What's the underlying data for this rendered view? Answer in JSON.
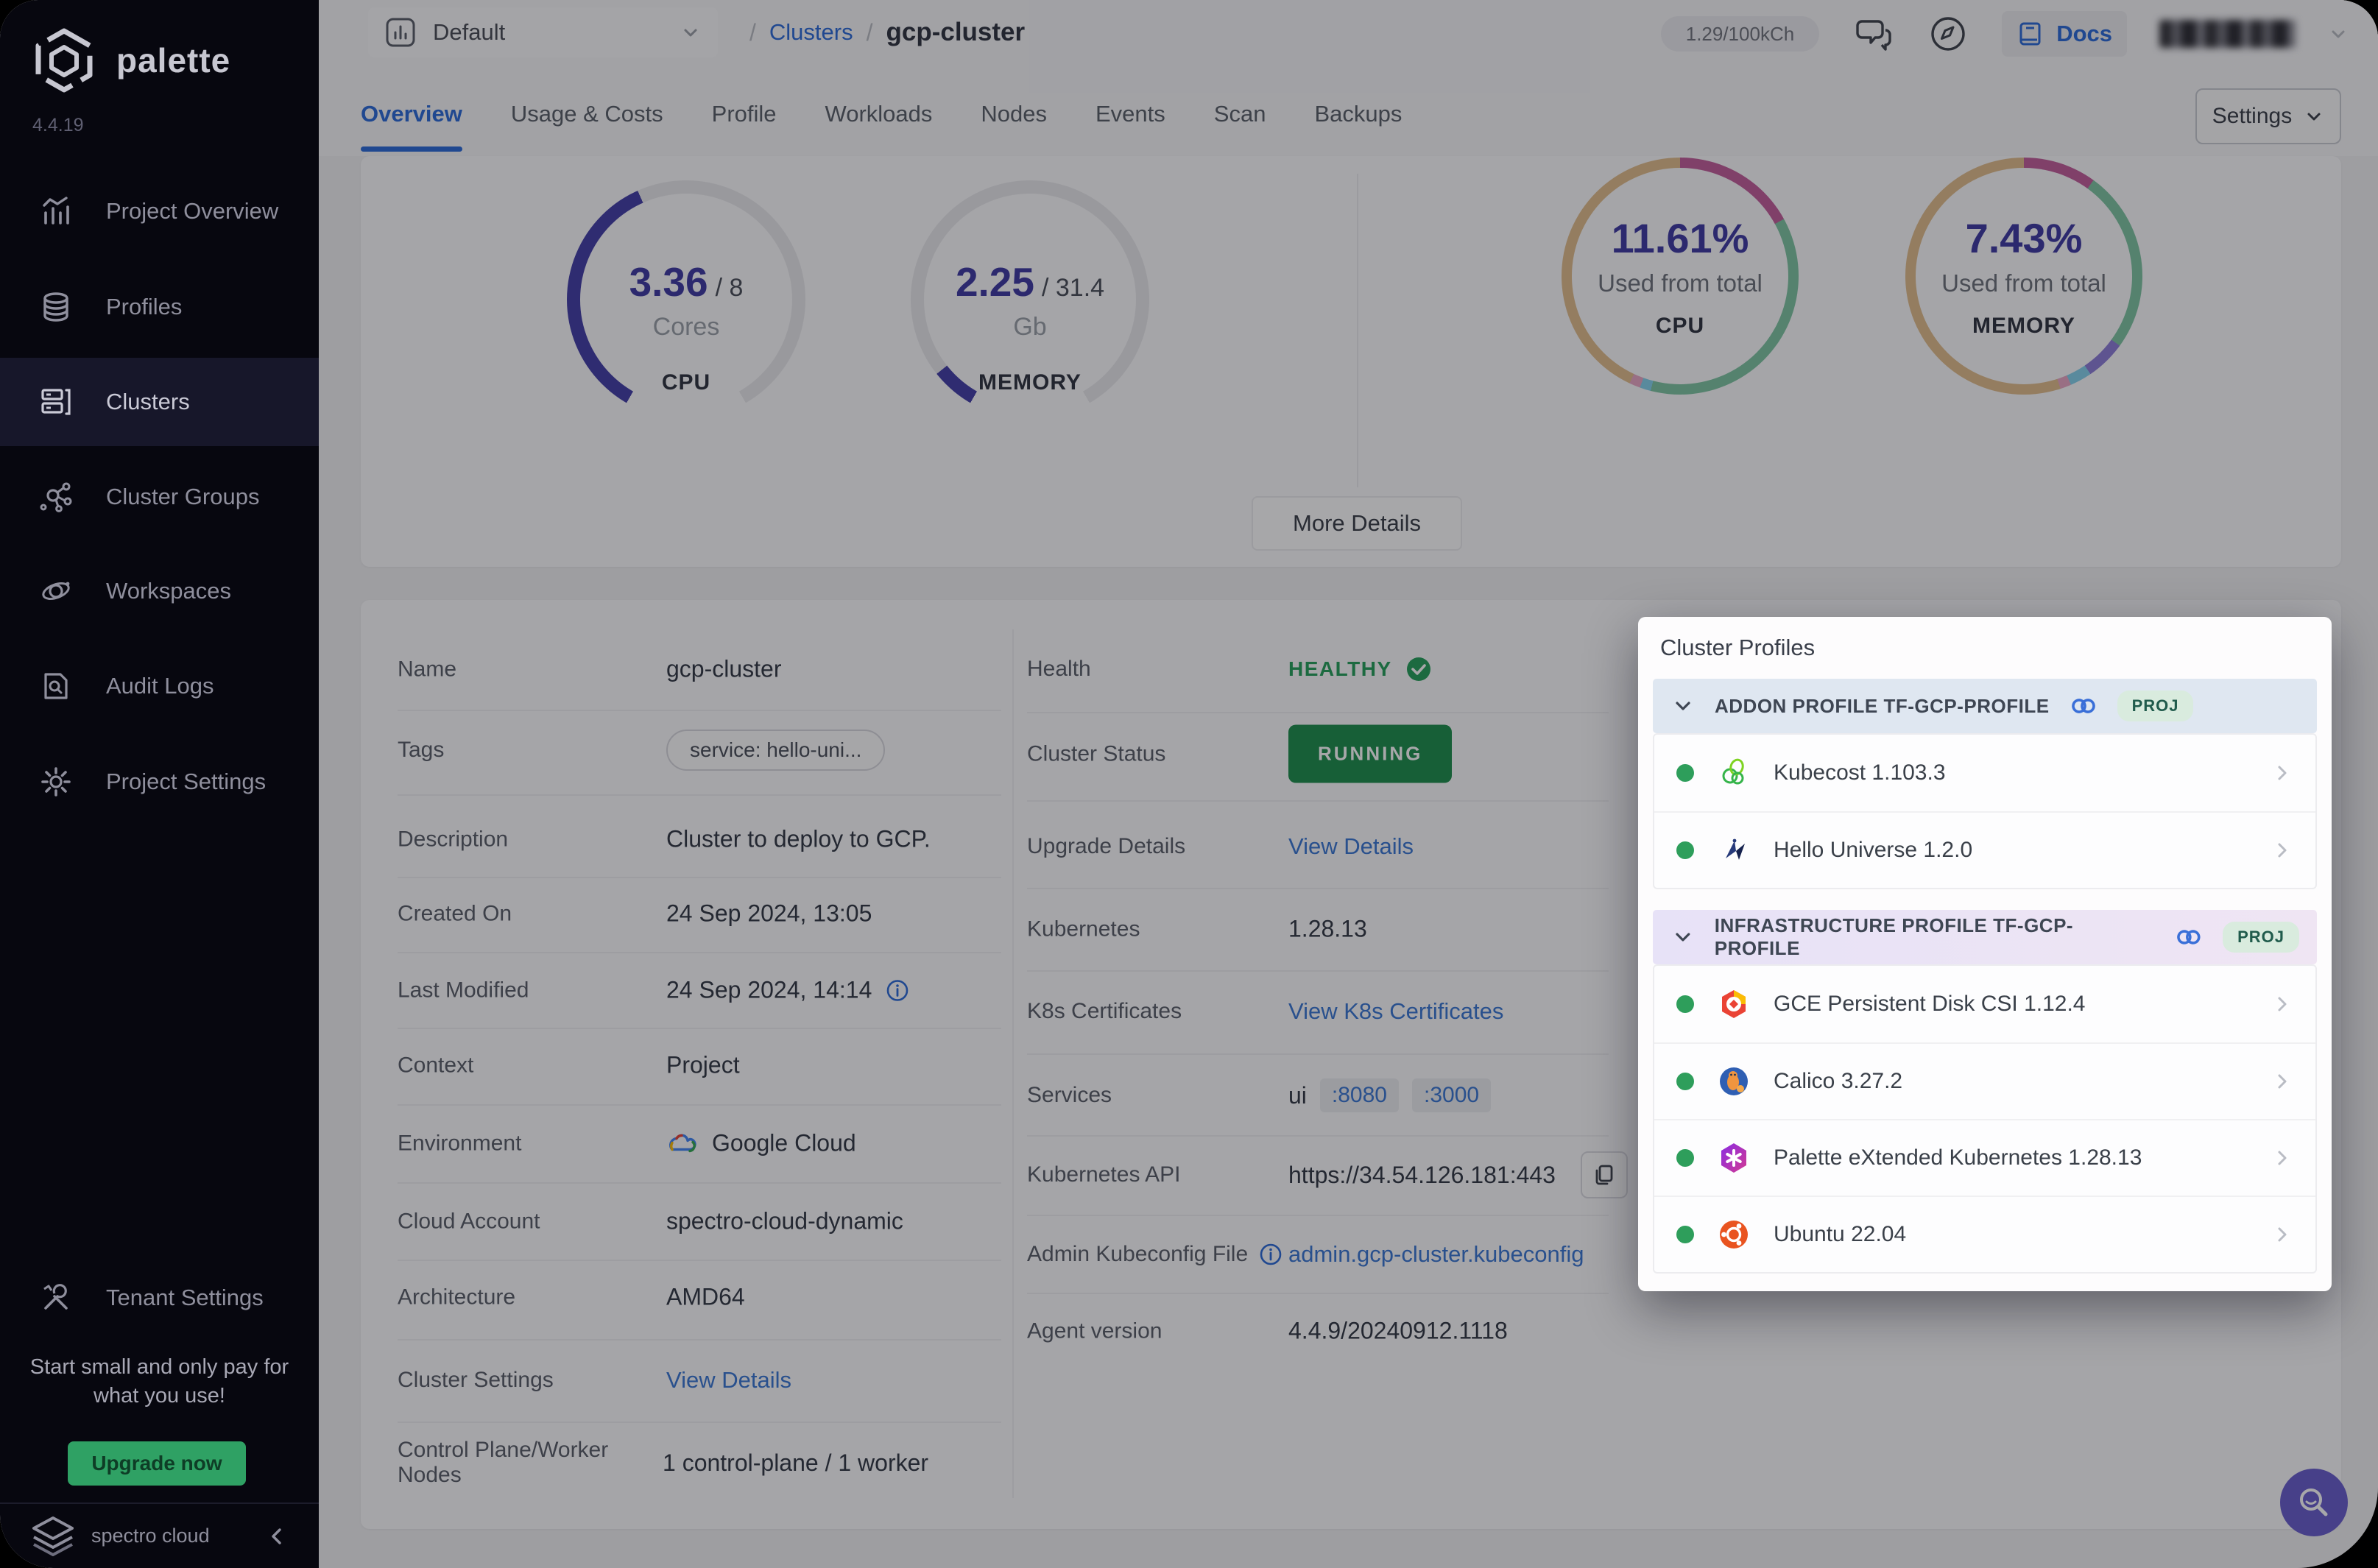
{
  "app": {
    "name": "palette",
    "version": "4.4.19"
  },
  "sidebar": {
    "items": [
      {
        "label": "Project Overview"
      },
      {
        "label": "Profiles"
      },
      {
        "label": "Clusters"
      },
      {
        "label": "Cluster Groups"
      },
      {
        "label": "Workspaces"
      },
      {
        "label": "Audit Logs"
      },
      {
        "label": "Project Settings"
      }
    ],
    "active": "Clusters",
    "tenant_settings_label": "Tenant Settings",
    "promo_text": "Start small and only pay for what you use!",
    "upgrade_label": "Upgrade now",
    "footer_brand": "spectro cloud"
  },
  "topbar": {
    "project_selector": "Default",
    "breadcrumb": {
      "sep": "/",
      "section": "Clusters",
      "current": "gcp-cluster"
    },
    "usage_pill": "1.29/100kCh",
    "docs_label": "Docs"
  },
  "tabs": {
    "items": [
      "Overview",
      "Usage & Costs",
      "Profile",
      "Workloads",
      "Nodes",
      "Events",
      "Scan",
      "Backups"
    ],
    "active": "Overview",
    "settings_label": "Settings"
  },
  "more_details_label": "More Details",
  "chart_data": [
    {
      "id": "cpu-gauge",
      "type": "gauge",
      "value": 3.36,
      "total": 8,
      "arc_degrees": 300,
      "value_text": "3.36",
      "total_text": "/ 8",
      "unit": "Cores",
      "caption": "CPU",
      "fill_color": "#443FA8",
      "track_color": "#E9E9ED"
    },
    {
      "id": "memory-gauge",
      "type": "gauge",
      "value": 2.25,
      "total": 31.4,
      "arc_degrees": 300,
      "value_text": "2.25",
      "total_text": "/ 31.4",
      "unit": "Gb",
      "caption": "MEMORY",
      "fill_color": "#443FA8",
      "track_color": "#E9E9ED"
    },
    {
      "id": "cpu-usage-donut",
      "type": "donut",
      "percent": 11.61,
      "pct_text": "11.61%",
      "subtitle": "Used from total",
      "caption": "CPU",
      "segments": [
        {
          "name": "magenta",
          "color": "#C25F9B",
          "pct": 17
        },
        {
          "name": "green",
          "color": "#7FC5A3",
          "pct": 37
        },
        {
          "name": "lightblue",
          "color": "#86D2EC",
          "pct": 1.5
        },
        {
          "name": "pink",
          "color": "#E9A8C6",
          "pct": 1.5
        },
        {
          "name": "tan",
          "color": "#E2BE8E",
          "pct": 43
        }
      ]
    },
    {
      "id": "memory-usage-donut",
      "type": "donut",
      "percent": 7.43,
      "pct_text": "7.43%",
      "subtitle": "Used from total",
      "caption": "MEMORY",
      "segments": [
        {
          "name": "magenta",
          "color": "#C25F9B",
          "pct": 10
        },
        {
          "name": "green",
          "color": "#7FC5A3",
          "pct": 25
        },
        {
          "name": "purple",
          "color": "#8E7ED8",
          "pct": 5.5
        },
        {
          "name": "lightblue",
          "color": "#86D2EC",
          "pct": 3
        },
        {
          "name": "pink",
          "color": "#E9A8C6",
          "pct": 1.5
        },
        {
          "name": "tan",
          "color": "#E2BE8E",
          "pct": 55
        }
      ]
    }
  ],
  "details": {
    "name": {
      "label": "Name",
      "value": "gcp-cluster"
    },
    "tags": {
      "label": "Tags",
      "value": "service: hello-uni..."
    },
    "description": {
      "label": "Description",
      "value": "Cluster to deploy to GCP."
    },
    "created_on": {
      "label": "Created On",
      "value": "24 Sep 2024, 13:05"
    },
    "last_modified": {
      "label": "Last Modified",
      "value": "24 Sep 2024, 14:14"
    },
    "context": {
      "label": "Context",
      "value": "Project"
    },
    "environment": {
      "label": "Environment",
      "value": "Google Cloud"
    },
    "cloud_account": {
      "label": "Cloud Account",
      "value": "spectro-cloud-dynamic"
    },
    "architecture": {
      "label": "Architecture",
      "value": "AMD64"
    },
    "cluster_settings": {
      "label": "Cluster Settings",
      "link": "View Details"
    },
    "nodes": {
      "label": "Control Plane/Worker Nodes",
      "value": "1 control-plane / 1 worker"
    },
    "health": {
      "label": "Health",
      "value": "HEALTHY"
    },
    "cluster_status": {
      "label": "Cluster Status",
      "value": "RUNNING"
    },
    "upgrade_details": {
      "label": "Upgrade Details",
      "link": "View Details"
    },
    "kubernetes": {
      "label": "Kubernetes",
      "value": "1.28.13"
    },
    "k8s_certificates": {
      "label": "K8s Certificates",
      "link": "View K8s Certificates"
    },
    "services": {
      "label": "Services",
      "prefix": "ui",
      "ports": [
        ":8080",
        ":3000"
      ]
    },
    "kubernetes_api": {
      "label": "Kubernetes API",
      "value": "https://34.54.126.181:443"
    },
    "admin_kubeconfig": {
      "label": "Admin Kubeconfig File",
      "link": "admin.gcp-cluster.kubeconfig"
    },
    "agent_version": {
      "label": "Agent version",
      "value": "4.4.9/20240912.1118"
    }
  },
  "cluster_profiles": {
    "title": "Cluster Profiles",
    "sections": [
      {
        "kind": "ADDON PROFILE",
        "name": "TF-GCP-PROFILE",
        "badge": "PROJ",
        "items": [
          {
            "name": "Kubecost 1.103.3"
          },
          {
            "name": "Hello Universe 1.2.0"
          }
        ]
      },
      {
        "kind": "INFRASTRUCTURE PROFILE",
        "name": "TF-GCP-PROFILE",
        "badge": "PROJ",
        "items": [
          {
            "name": "GCE Persistent Disk CSI 1.12.4"
          },
          {
            "name": "Calico 3.27.2"
          },
          {
            "name": "Palette eXtended Kubernetes 1.28.13"
          },
          {
            "name": "Ubuntu 22.04"
          }
        ]
      }
    ]
  },
  "colors": {
    "accent_blue": "#2D6BD8",
    "link_blue": "#3B77D3",
    "healthy_green": "#27A05C",
    "running_green": "#1F8F4E",
    "gauge_indigo": "#443FA8",
    "upgrade_green": "#2FA164",
    "sidebar_bg": "#07070F",
    "fab_indigo": "#6A5FCE"
  }
}
